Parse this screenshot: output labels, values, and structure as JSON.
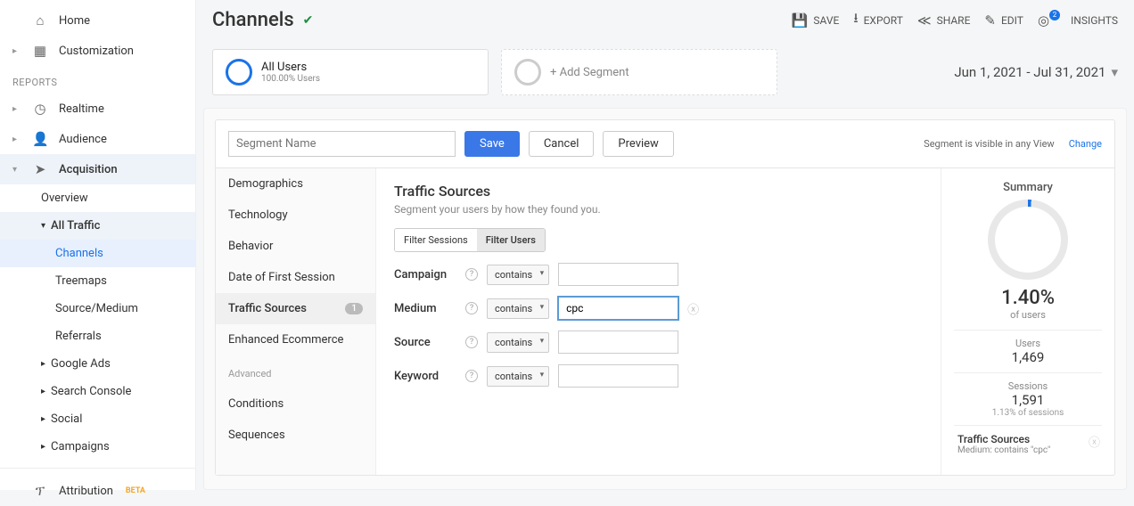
{
  "sidebar": {
    "home": "Home",
    "customization": "Customization",
    "reports_label": "REPORTS",
    "realtime": "Realtime",
    "audience": "Audience",
    "acquisition": "Acquisition",
    "overview": "Overview",
    "all_traffic": "All Traffic",
    "channels": "Channels",
    "treemaps": "Treemaps",
    "source_medium": "Source/Medium",
    "referrals": "Referrals",
    "google_ads": "Google Ads",
    "search_console": "Search Console",
    "social": "Social",
    "campaigns": "Campaigns",
    "attribution": "Attribution",
    "beta": "BETA"
  },
  "header": {
    "title": "Channels",
    "save": "SAVE",
    "export": "EXPORT",
    "share": "SHARE",
    "edit": "EDIT",
    "insights": "INSIGHTS",
    "notif_count": "2"
  },
  "segments": {
    "all_users": "All Users",
    "all_users_sub": "100.00% Users",
    "add_segment": "+ Add Segment",
    "daterange": "Jun 1, 2021 - Jul 31, 2021"
  },
  "builder": {
    "segment_name_placeholder": "Segment Name",
    "save": "Save",
    "cancel": "Cancel",
    "preview": "Preview",
    "visible": "Segment is visible in any View",
    "change": "Change",
    "cats": {
      "demographics": "Demographics",
      "technology": "Technology",
      "behavior": "Behavior",
      "date_first": "Date of First Session",
      "traffic_sources": "Traffic Sources",
      "traffic_badge": "1",
      "enhanced": "Enhanced Ecommerce",
      "advanced": "Advanced",
      "conditions": "Conditions",
      "sequences": "Sequences"
    },
    "form": {
      "title": "Traffic Sources",
      "desc": "Segment your users by how they found you.",
      "filter_sessions": "Filter Sessions",
      "filter_users": "Filter Users",
      "campaign": "Campaign",
      "medium": "Medium",
      "source": "Source",
      "keyword": "Keyword",
      "contains": "contains",
      "medium_value": "cpc"
    }
  },
  "summary": {
    "title": "Summary",
    "pct": "1.40%",
    "of_users": "of users",
    "users_label": "Users",
    "users_val": "1,469",
    "sessions_label": "Sessions",
    "sessions_val": "1,591",
    "sessions_sub": "1.13% of sessions",
    "ts_title": "Traffic Sources",
    "ts_desc": "Medium: contains \"cpc\""
  }
}
